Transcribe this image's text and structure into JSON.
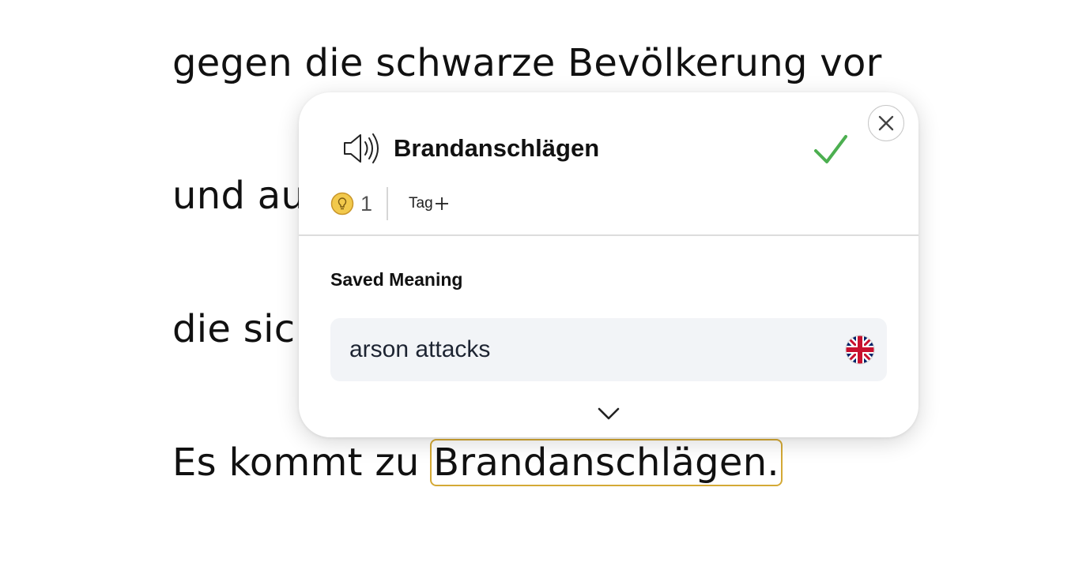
{
  "reader": {
    "lines": [
      "gegen die schwarze Bevölkerung vor",
      "und au",
      "die sic",
      "Es kommt zu "
    ],
    "highlighted_word": "Brandanschlägen.",
    "highlight_color": "#d4a935"
  },
  "popup": {
    "headword": "Brandanschlägen",
    "lookup_count": "1",
    "tag_label": "Tag",
    "section_title": "Saved Meaning",
    "meaning": "arson attacks",
    "meaning_language_icon": "uk-flag-icon",
    "icons": [
      "speaker-icon",
      "checkmark-icon",
      "close-icon",
      "lightbulb-icon",
      "plus-icon",
      "chevron-down-icon"
    ],
    "colors": {
      "check": "#4caf50",
      "bulb": "#f2c94c",
      "meaning_bg": "#f2f4f7"
    }
  }
}
